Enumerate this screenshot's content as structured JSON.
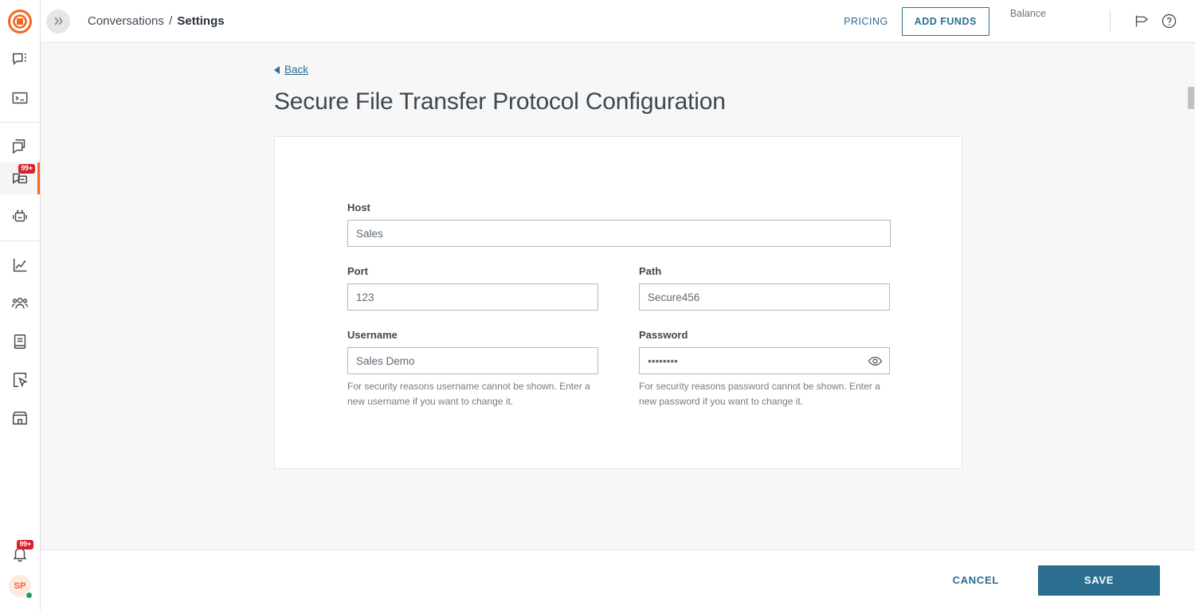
{
  "brand": {
    "logo_icon": "target-logo-icon",
    "accent": "#f26722"
  },
  "header": {
    "collapse_icon": "chevron-double-right-icon",
    "breadcrumb": {
      "parent": "Conversations",
      "separator": "/",
      "current": "Settings"
    },
    "pricing_label": "PRICING",
    "add_funds_label": "ADD FUNDS",
    "balance_label": "Balance",
    "announcement_icon": "megaphone-icon",
    "help_icon": "help-circle-icon"
  },
  "sidebar": {
    "groups": [
      {
        "items": [
          {
            "name": "conversations",
            "icon": "chat-bubble-dots-icon",
            "active": false
          },
          {
            "name": "console",
            "icon": "terminal-icon",
            "active": false
          }
        ]
      },
      {
        "items": [
          {
            "name": "templates",
            "icon": "copy-chat-icon",
            "active": false
          },
          {
            "name": "inbox",
            "icon": "inbox-tray-icon",
            "active": true,
            "badge": "99+"
          },
          {
            "name": "bots",
            "icon": "robot-icon",
            "active": false
          }
        ]
      },
      {
        "items": [
          {
            "name": "analytics",
            "icon": "line-chart-icon",
            "active": false
          },
          {
            "name": "contacts",
            "icon": "people-group-icon",
            "active": false
          },
          {
            "name": "documents",
            "icon": "book-icon",
            "active": false
          },
          {
            "name": "campaigns",
            "icon": "cursor-frame-icon",
            "active": false
          },
          {
            "name": "marketplace",
            "icon": "storefront-icon",
            "active": false
          }
        ]
      }
    ],
    "notifications": {
      "icon": "bell-icon",
      "badge": "99+"
    },
    "profile": {
      "initials": "SP",
      "status": "online"
    }
  },
  "main": {
    "back_label": "Back",
    "title": "Secure File Transfer Protocol Configuration",
    "fields": {
      "host": {
        "label": "Host",
        "value": "Sales"
      },
      "port": {
        "label": "Port",
        "value": "123"
      },
      "path": {
        "label": "Path",
        "value": "Secure456"
      },
      "username": {
        "label": "Username",
        "value": "Sales Demo",
        "helper": "For security reasons username cannot be shown. Enter a new username if you want to change it."
      },
      "password": {
        "label": "Password",
        "value": "••••••••",
        "toggle_icon": "eye-icon",
        "helper": "For security reasons password cannot be shown. Enter a new password if you want to change it."
      }
    }
  },
  "footer": {
    "cancel_label": "CANCEL",
    "save_label": "SAVE",
    "save_color": "#2b6e8f"
  }
}
